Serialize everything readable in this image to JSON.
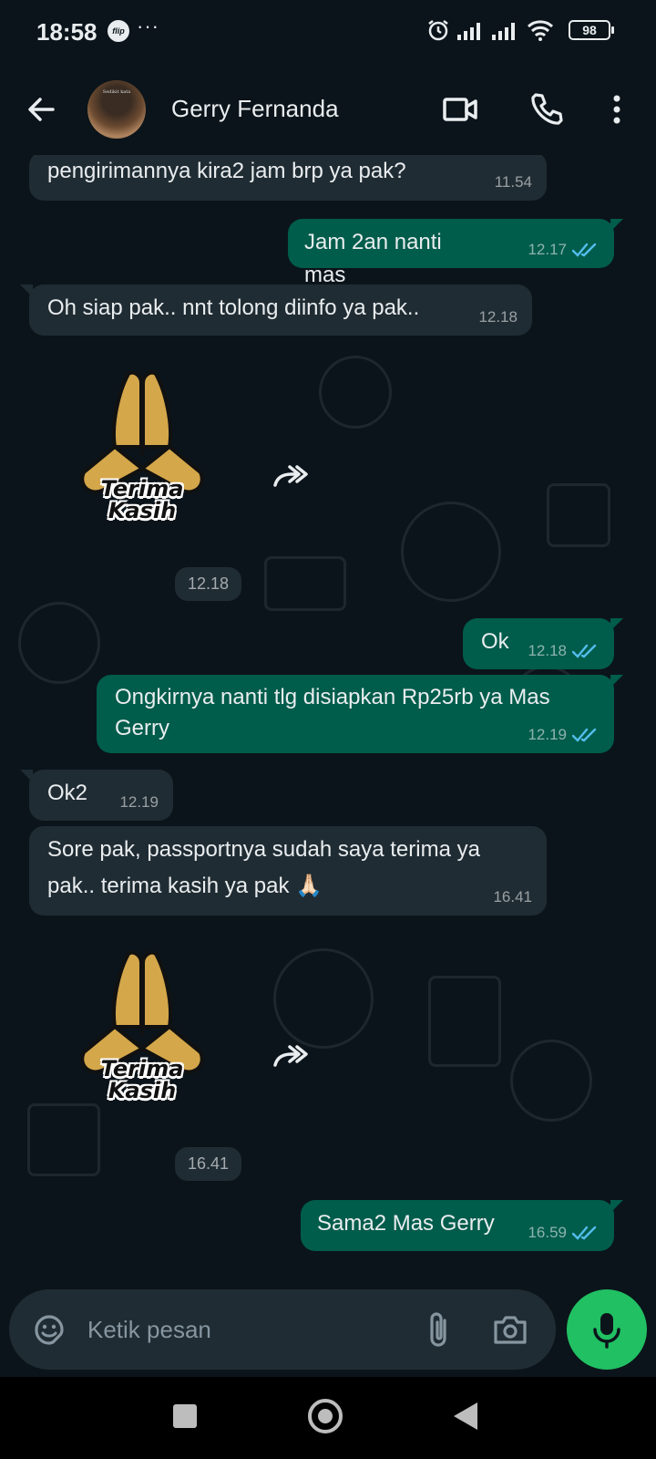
{
  "status_bar": {
    "time": "18:58",
    "badge": "flip",
    "more": "···",
    "battery": "98"
  },
  "header": {
    "contact_name": "Gerry Fernanda",
    "avatar_text": "Sedikit kata"
  },
  "messages": [
    {
      "direction": "in",
      "text": "pengirimannya kira2 jam brp ya pak?",
      "time": "11.54"
    },
    {
      "direction": "out",
      "text": "Jam 2an nanti mas",
      "time": "12.17",
      "status": "read"
    },
    {
      "direction": "in",
      "text": "Oh siap pak.. nnt tolong diinfo ya pak..",
      "time": "12.18"
    },
    {
      "direction": "in",
      "type": "sticker",
      "sticker_line1": "Terima",
      "sticker_line2": "Kasih",
      "time": "12.18"
    },
    {
      "direction": "out",
      "text": "Ok",
      "time": "12.18",
      "status": "read"
    },
    {
      "direction": "out",
      "text": "Ongkirnya nanti tlg disiapkan Rp25rb ya Mas Gerry",
      "time": "12.19",
      "status": "read"
    },
    {
      "direction": "in",
      "text": "Ok2",
      "time": "12.19"
    },
    {
      "direction": "in",
      "text": "Sore pak, passportnya sudah saya terima ya pak.. terima kasih ya pak 🙏🏻",
      "time": "16.41"
    },
    {
      "direction": "in",
      "type": "sticker",
      "sticker_line1": "Terima",
      "sticker_line2": "Kasih",
      "time": "16.41"
    },
    {
      "direction": "out",
      "text": "Sama2 Mas Gerry",
      "time": "16.59",
      "status": "read"
    }
  ],
  "input": {
    "placeholder": "Ketik pesan"
  },
  "colors": {
    "background": "#0b141a",
    "incoming_bubble": "#202c33",
    "outgoing_bubble": "#005c4b",
    "mic_button": "#21c063",
    "read_ticks": "#53bdeb"
  },
  "icons": {
    "back": "arrow-left-icon",
    "video": "video-camera-icon",
    "call": "phone-icon",
    "menu": "more-vertical-icon",
    "forward": "forward-icon",
    "emoji": "sticker-icon",
    "attach": "paperclip-icon",
    "camera": "camera-icon",
    "mic": "microphone-icon"
  }
}
